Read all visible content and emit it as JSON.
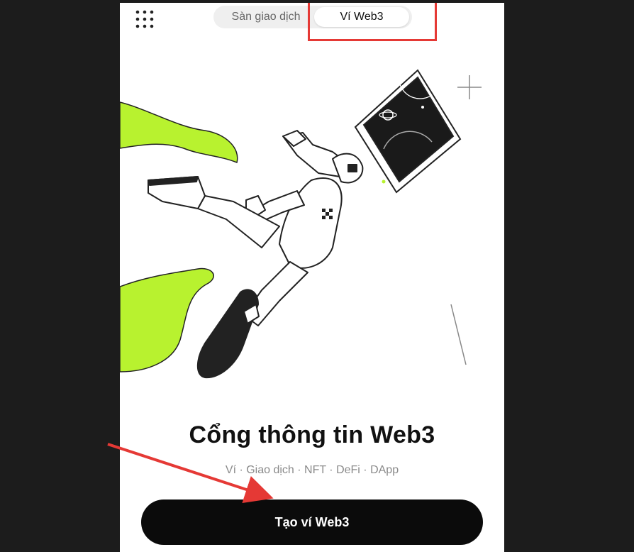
{
  "header": {
    "menu_icon": "grid-dots-icon",
    "tabs": [
      {
        "label": "Sàn giao dịch",
        "active": false
      },
      {
        "label": "Ví Web3",
        "active": true
      }
    ]
  },
  "hero": {
    "title": "Cổng thông tin Web3",
    "subtitle": "Ví · Giao dịch · NFT · DeFi · DApp"
  },
  "cta": {
    "label": "Tạo ví Web3"
  },
  "colors": {
    "accent_green": "#b8f22f",
    "highlight_red": "#e53935",
    "button_bg": "#0b0b0b"
  }
}
